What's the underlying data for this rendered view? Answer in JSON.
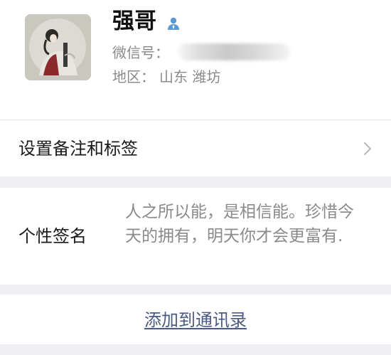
{
  "profile": {
    "name": "强哥",
    "wechat_id_label": "微信号：",
    "region_label": "地区：",
    "region_value": "山东  潍坊"
  },
  "remark": {
    "label": "设置备注和标签"
  },
  "signature": {
    "label": "个性签名",
    "text": "人之所以能，是相信能。珍惜今天的拥有，明天你才会更富有."
  },
  "actions": {
    "add_to_contacts": "添加到通讯录"
  },
  "colors": {
    "link": "#4a5a86",
    "secondary_text": "#8a8a8a",
    "separator": "#efeff4",
    "verify_icon": "#5b9bd5"
  },
  "icons": {
    "verify": "person-icon",
    "remark_arrow": "chevron-right-icon"
  }
}
